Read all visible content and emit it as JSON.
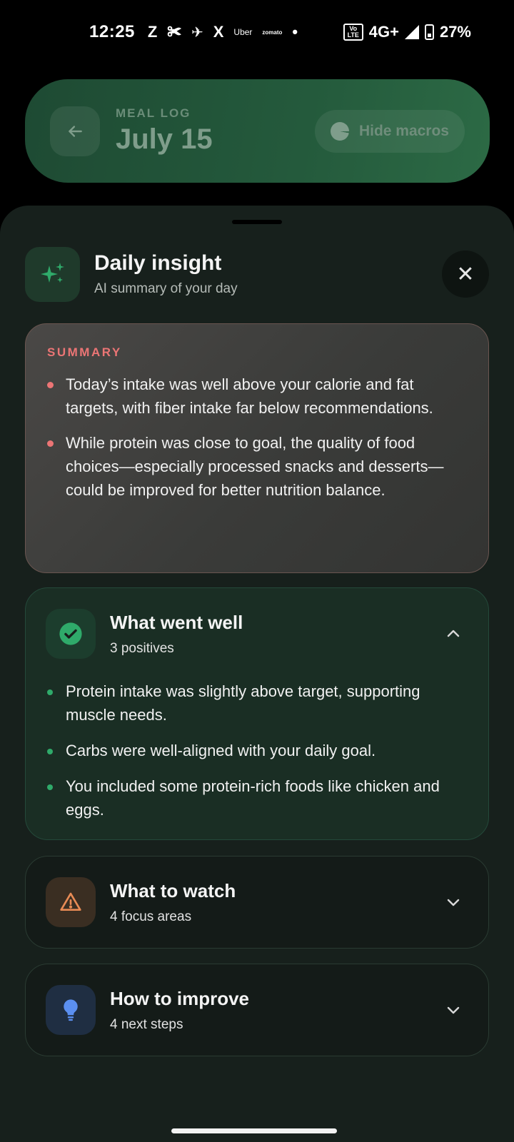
{
  "status_bar": {
    "time": "12:25",
    "apps": [
      "Z",
      "✀",
      "✈",
      "X",
      "Uber",
      "zomato",
      "•"
    ],
    "volte": "Vo LTE",
    "network": "4G+",
    "battery": "27%"
  },
  "header": {
    "kicker": "MEAL LOG",
    "title": "July 15",
    "hide_macros_label": "Hide macros"
  },
  "sheet": {
    "title": "Daily insight",
    "subtitle": "AI summary of your day",
    "close_glyph": "✕"
  },
  "summary": {
    "kicker": "SUMMARY",
    "bullets": [
      "Today’s intake was well above your calorie and fat targets, with fiber intake far below recommendations.",
      "While protein was close to goal, the quality of food choices—especially processed snacks and desserts—could be improved for better nutrition balance."
    ]
  },
  "sections": [
    {
      "title": "What went well",
      "subtitle": "3 positives",
      "icon": "check-circle-icon",
      "expanded": true,
      "items": [
        "Protein intake was slightly above target, supporting muscle needs.",
        "Carbs were well-aligned with your daily goal.",
        "You included some protein-rich foods like chicken and eggs."
      ]
    },
    {
      "title": "What to watch",
      "subtitle": "4 focus areas",
      "icon": "warning-triangle-icon",
      "expanded": false
    },
    {
      "title": "How to improve",
      "subtitle": "4 next steps",
      "icon": "lightbulb-icon",
      "expanded": false
    }
  ],
  "colors": {
    "summary_accent": "#ec7575",
    "well_accent": "#2faa6a",
    "watch_accent": "#e88b55",
    "improve_accent": "#5b8ff0",
    "sheet_bg": "#17201c"
  }
}
